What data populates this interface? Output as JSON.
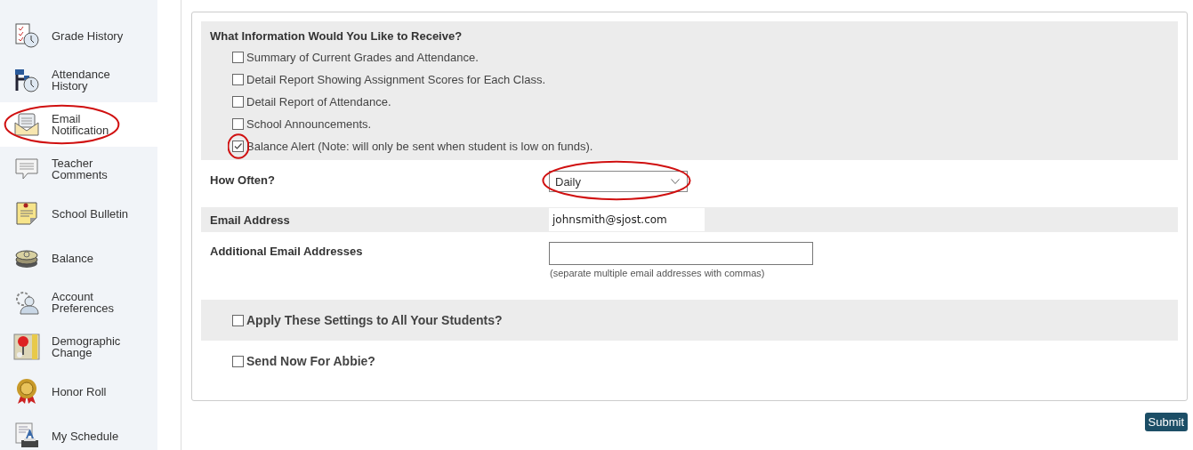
{
  "sidebar": {
    "items": [
      {
        "kind": "grades",
        "label": "Grade History",
        "selected": false,
        "circled": false
      },
      {
        "kind": "attendance",
        "label": "Attendance History",
        "selected": false,
        "circled": false
      },
      {
        "kind": "email",
        "label": "Email Notification",
        "selected": true,
        "circled": true
      },
      {
        "kind": "comments",
        "label": "Teacher Comments",
        "selected": false,
        "circled": false
      },
      {
        "kind": "bulletin",
        "label": "School Bulletin",
        "selected": false,
        "circled": false
      },
      {
        "kind": "balance",
        "label": "Balance",
        "selected": false,
        "circled": false
      },
      {
        "kind": "account",
        "label": "Account Preferences",
        "selected": false,
        "circled": false
      },
      {
        "kind": "demographic",
        "label": "Demographic Change",
        "selected": false,
        "circled": false
      },
      {
        "kind": "honor",
        "label": "Honor Roll",
        "selected": false,
        "circled": false
      },
      {
        "kind": "schedule",
        "label": "My Schedule",
        "selected": false,
        "circled": false
      }
    ]
  },
  "form": {
    "info_section": {
      "heading": "What Information Would You Like to Receive?",
      "options": [
        {
          "label": "Summary of Current Grades and Attendance.",
          "checked": false,
          "circled": false
        },
        {
          "label": "Detail Report Showing Assignment Scores for Each Class.",
          "checked": false,
          "circled": false
        },
        {
          "label": "Detail Report of Attendance.",
          "checked": false,
          "circled": false
        },
        {
          "label": "School Announcements.",
          "checked": false,
          "circled": false
        },
        {
          "label": "Balance Alert (Note: will only be sent when student is low on funds).",
          "checked": true,
          "circled": true
        }
      ]
    },
    "how_often": {
      "label": "How Often?",
      "value": "Daily",
      "circled": true
    },
    "email_address": {
      "label": "Email Address",
      "value": "johnsmith@sjost.com"
    },
    "additional_emails": {
      "label": "Additional Email Addresses",
      "hint": "(separate multiple email addresses with commas)"
    },
    "apply_all": {
      "label": "Apply These Settings to All Your Students?",
      "checked": false
    },
    "send_now": {
      "label": "Send Now For Abbie?",
      "checked": false
    }
  },
  "submit": {
    "label": "Submit"
  }
}
